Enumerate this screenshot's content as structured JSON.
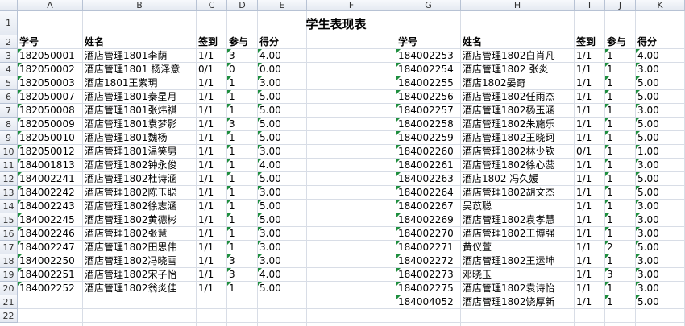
{
  "columns": [
    "A",
    "B",
    "C",
    "D",
    "E",
    "F",
    "G",
    "H",
    "I",
    "J",
    "K"
  ],
  "rows": [
    "1",
    "2",
    "3",
    "4",
    "5",
    "6",
    "7",
    "8",
    "9",
    "10",
    "11",
    "12",
    "13",
    "14",
    "15",
    "16",
    "17",
    "18",
    "19",
    "20",
    "21",
    "22"
  ],
  "title": "学生表现表",
  "headers": {
    "id": "学号",
    "name": "姓名",
    "signin": "签到",
    "participate": "参与",
    "score": "得分"
  },
  "left_table": [
    {
      "id": "182050001",
      "name": "酒店管理1801李荫",
      "signin": "1/1",
      "participate": "3",
      "score": "4.00"
    },
    {
      "id": "182050002",
      "name": "酒店管理1801 杨泽意",
      "signin": "0/1",
      "participate": "0",
      "score": "0.00"
    },
    {
      "id": "182050003",
      "name": "酒店1801王紫玥",
      "signin": "1/1",
      "participate": "1",
      "score": "3.00"
    },
    {
      "id": "182050007",
      "name": "酒店管理1801秦星月",
      "signin": "1/1",
      "participate": "1",
      "score": "5.00"
    },
    {
      "id": "182050008",
      "name": "酒店管理1801张炜祺",
      "signin": "1/1",
      "participate": "1",
      "score": "5.00"
    },
    {
      "id": "182050009",
      "name": "酒店管理1801袁梦影",
      "signin": "1/1",
      "participate": "3",
      "score": "5.00"
    },
    {
      "id": "182050010",
      "name": "酒店管理1801魏杨",
      "signin": "1/1",
      "participate": "1",
      "score": "5.00"
    },
    {
      "id": "182050012",
      "name": "酒店管理1801温笑男",
      "signin": "1/1",
      "participate": "1",
      "score": "3.00"
    },
    {
      "id": "184001813",
      "name": "酒店管理1802钟永俊",
      "signin": "1/1",
      "participate": "1",
      "score": "4.00"
    },
    {
      "id": "184002241",
      "name": "酒店管理1802杜诗涵",
      "signin": "1/1",
      "participate": "1",
      "score": "5.00"
    },
    {
      "id": "184002242",
      "name": "酒店管理1802陈玉聪",
      "signin": "1/1",
      "participate": "1",
      "score": "3.00"
    },
    {
      "id": "184002243",
      "name": "酒店管理1802徐志涵",
      "signin": "1/1",
      "participate": "1",
      "score": "5.00"
    },
    {
      "id": "184002245",
      "name": "酒店管理1802黄德彬",
      "signin": "1/1",
      "participate": "1",
      "score": "5.00"
    },
    {
      "id": "184002246",
      "name": "酒店管理1802张慧",
      "signin": "1/1",
      "participate": "1",
      "score": "3.00"
    },
    {
      "id": "184002247",
      "name": "酒店管理1802田思伟",
      "signin": "1/1",
      "participate": "1",
      "score": "3.00"
    },
    {
      "id": "184002250",
      "name": "酒店管理1802冯晓雪",
      "signin": "1/1",
      "participate": "3",
      "score": "3.00"
    },
    {
      "id": "184002251",
      "name": "酒店管理1802宋子怡",
      "signin": "1/1",
      "participate": "3",
      "score": "4.00"
    },
    {
      "id": "184002252",
      "name": "酒店管理1802翁炎佳",
      "signin": "1/1",
      "participate": "1",
      "score": "5.00"
    }
  ],
  "right_table": [
    {
      "id": "184002253",
      "name": "酒店管理1802白肖凡",
      "signin": "1/1",
      "participate": "1",
      "score": "4.00"
    },
    {
      "id": "184002254",
      "name": "酒店管理1802  张炎",
      "signin": "1/1",
      "participate": "1",
      "score": "3.00"
    },
    {
      "id": "184002255",
      "name": "酒店1802晏奇",
      "signin": "1/1",
      "participate": "1",
      "score": "5.00"
    },
    {
      "id": "184002256",
      "name": "酒店管理1802任雨杰",
      "signin": "1/1",
      "participate": "1",
      "score": "5.00"
    },
    {
      "id": "184002257",
      "name": "酒店管理1802杨玉涵",
      "signin": "1/1",
      "participate": "1",
      "score": "3.00"
    },
    {
      "id": "184002258",
      "name": "酒店管理1802朱施乐",
      "signin": "1/1",
      "participate": "1",
      "score": "5.00"
    },
    {
      "id": "184002259",
      "name": "酒店管理1802王晓珂",
      "signin": "1/1",
      "participate": "1",
      "score": "5.00"
    },
    {
      "id": "184002260",
      "name": "酒店管理1802林少钦",
      "signin": "0/1",
      "participate": "1",
      "score": "1.00"
    },
    {
      "id": "184002261",
      "name": "酒店管理1802徐心蕊",
      "signin": "1/1",
      "participate": "1",
      "score": "3.00"
    },
    {
      "id": "184002263",
      "name": "酒店1802 冯久媛",
      "signin": "1/1",
      "participate": "1",
      "score": "5.00"
    },
    {
      "id": "184002264",
      "name": "酒店管理1802胡文杰",
      "signin": "1/1",
      "participate": "1",
      "score": "5.00"
    },
    {
      "id": "184002267",
      "name": "吴苡聪",
      "signin": "1/1",
      "participate": "1",
      "score": "3.00"
    },
    {
      "id": "184002269",
      "name": "酒店管理1802袁孝慧",
      "signin": "1/1",
      "participate": "1",
      "score": "3.00"
    },
    {
      "id": "184002270",
      "name": "酒店管理1802王博强",
      "signin": "1/1",
      "participate": "1",
      "score": "3.00"
    },
    {
      "id": "184002271",
      "name": "黄仪萱",
      "signin": "1/1",
      "participate": "2",
      "score": "5.00"
    },
    {
      "id": "184002272",
      "name": "酒店管理1802王运坤",
      "signin": "1/1",
      "participate": "1",
      "score": "3.00"
    },
    {
      "id": "184002273",
      "name": "邓晓玉",
      "signin": "1/1",
      "participate": "3",
      "score": "3.00"
    },
    {
      "id": "184002275",
      "name": "酒店管理1802袁诗怡",
      "signin": "1/1",
      "participate": "1",
      "score": "3.00"
    },
    {
      "id": "184004052",
      "name": "酒店管理1802饶厚新",
      "signin": "1/1",
      "participate": "1",
      "score": "5.00"
    }
  ]
}
